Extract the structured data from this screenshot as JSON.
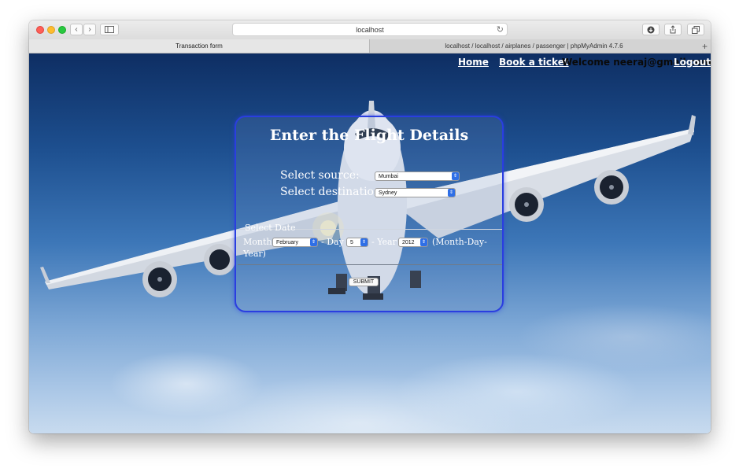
{
  "browser": {
    "address": "localhost",
    "tabs": [
      {
        "label": "Transaction form",
        "active": true
      },
      {
        "label": "localhost / localhost / airplanes / passenger | phpMyAdmin 4.7.6",
        "active": false
      }
    ],
    "new_tab": "+"
  },
  "nav": {
    "home": "Home",
    "book": "Book a ticket",
    "welcome": "Welcome neeraj@gmail.com",
    "logout": "Logout"
  },
  "form": {
    "title": "Enter the Flight Details",
    "source_label": "Select source:",
    "source_value": "Mumbai",
    "destination_label": "Select destination:",
    "destination_value": "Sydney",
    "date_legend": "Select Date",
    "month_label": "Month",
    "month_value": "February",
    "day_label": "- Day",
    "day_value": "5",
    "year_label": "- Year",
    "year_value": "2012",
    "format_hint_1": "(Month-Day-",
    "format_hint_2": "Year)",
    "submit_label": "SUBMIT"
  },
  "colors": {
    "panel_border": "#2a3ee0",
    "select_arrow": "#2f6fe6",
    "sky_top": "#0e2e63",
    "sky_bottom": "#c8dbef"
  }
}
